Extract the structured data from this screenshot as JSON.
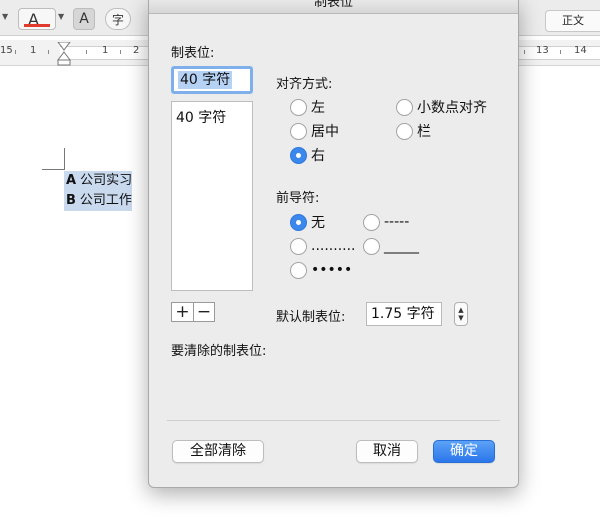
{
  "window": {
    "title": "制表位"
  },
  "toolbar": {
    "font_color_glyph": "A",
    "highlight_glyph": "A",
    "phonetic_glyph": "字",
    "style_label": "正文"
  },
  "ruler": {
    "numbers": [
      "1",
      "1",
      "2",
      "13",
      "14",
      "15"
    ]
  },
  "document": {
    "lines": [
      {
        "prefix": "A",
        "text": "公司实习"
      },
      {
        "prefix": "B",
        "text": "公司工作"
      }
    ]
  },
  "tab_stops": {
    "label": "制表位:",
    "input_value": "40 字符",
    "list": [
      "40 字符"
    ],
    "add_label": "+",
    "remove_label": "−"
  },
  "alignment": {
    "label": "对齐方式:",
    "options": [
      {
        "label": "左",
        "selected": false
      },
      {
        "label": "居中",
        "selected": false
      },
      {
        "label": "右",
        "selected": true
      },
      {
        "label": "小数点对齐",
        "selected": false
      },
      {
        "label": "栏",
        "selected": false
      }
    ]
  },
  "leader": {
    "label": "前导符:",
    "options": [
      {
        "label": "无",
        "selected": true
      },
      {
        "label": "-----",
        "selected": false
      },
      {
        "label": "..........",
        "selected": false
      },
      {
        "label": "_____",
        "selected": false
      },
      {
        "label": "•••••",
        "selected": false
      }
    ]
  },
  "default_tab": {
    "label": "默认制表位:",
    "value": "1.75 字符"
  },
  "clear_label": "要清除的制表位:",
  "buttons": {
    "clear_all": "全部清除",
    "cancel": "取消",
    "ok": "确定"
  },
  "colors": {
    "accent": "#2a76ea",
    "selection": "#b5d2f5",
    "font_red": "#e23b2e"
  }
}
